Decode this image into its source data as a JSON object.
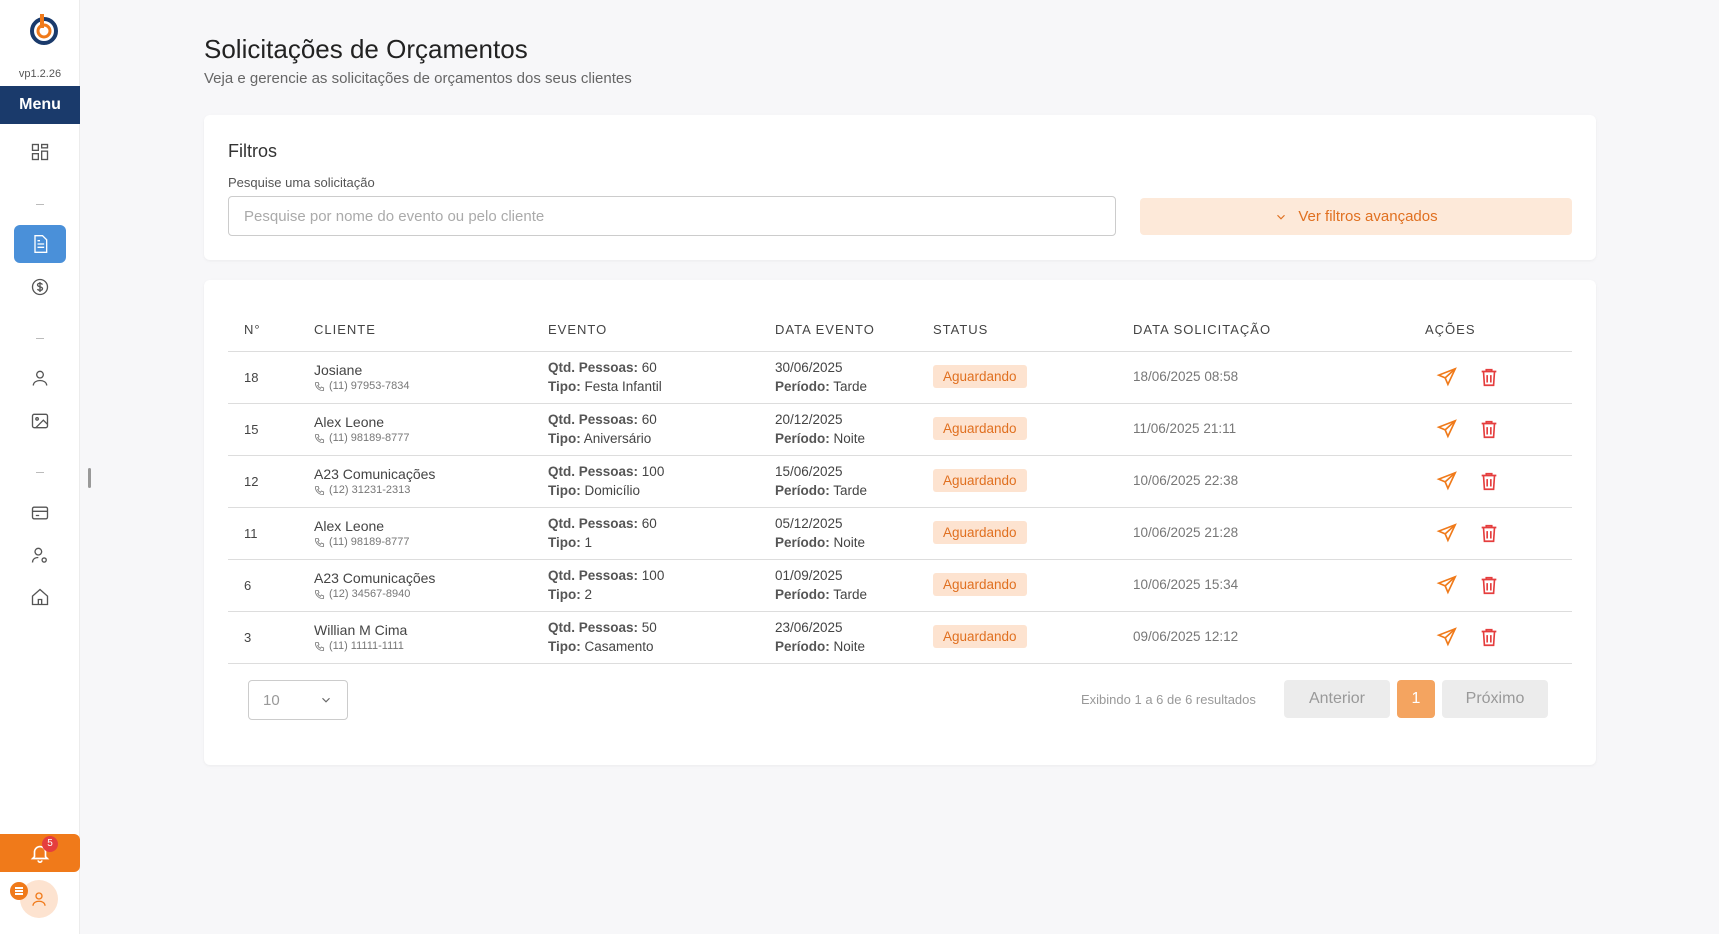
{
  "app": {
    "version": "vp1.2.26",
    "menu_label": "Menu",
    "notification_count": "5"
  },
  "header": {
    "title": "Solicitações de Orçamentos",
    "subtitle": "Veja e gerencie as solicitações de orçamentos dos seus clientes"
  },
  "filters": {
    "title": "Filtros",
    "search_label": "Pesquise uma solicitação",
    "search_placeholder": "Pesquise por nome do evento ou pelo cliente",
    "search_value": "",
    "advanced_label": "Ver filtros avançados"
  },
  "table": {
    "columns": [
      "N°",
      "CLIENTE",
      "EVENTO",
      "DATA EVENTO",
      "STATUS",
      "DATA SOLICITAÇÃO",
      "AÇÕES"
    ],
    "qtd_label": "Qtd. Pessoas:",
    "tipo_label": "Tipo:",
    "periodo_label": "Período:",
    "rows": [
      {
        "num": "18",
        "client": "Josiane",
        "phone": "(11) 97953-7834",
        "qtd": "60",
        "tipo": "Festa Infantil",
        "date": "30/06/2025",
        "periodo": "Tarde",
        "status": "Aguardando",
        "requested": "18/06/2025 08:58"
      },
      {
        "num": "15",
        "client": "Alex Leone",
        "phone": "(11) 98189-8777",
        "qtd": "60",
        "tipo": "Aniversário",
        "date": "20/12/2025",
        "periodo": "Noite",
        "status": "Aguardando",
        "requested": "11/06/2025 21:11"
      },
      {
        "num": "12",
        "client": "A23 Comunicações",
        "phone": "(12) 31231-2313",
        "qtd": "100",
        "tipo": "Domicílio",
        "date": "15/06/2025",
        "periodo": "Tarde",
        "status": "Aguardando",
        "requested": "10/06/2025 22:38"
      },
      {
        "num": "11",
        "client": "Alex Leone",
        "phone": "(11) 98189-8777",
        "qtd": "60",
        "tipo": "1",
        "date": "05/12/2025",
        "periodo": "Noite",
        "status": "Aguardando",
        "requested": "10/06/2025 21:28"
      },
      {
        "num": "6",
        "client": "A23 Comunicações",
        "phone": "(12) 34567-8940",
        "qtd": "100",
        "tipo": "2",
        "date": "01/09/2025",
        "periodo": "Tarde",
        "status": "Aguardando",
        "requested": "10/06/2025 15:34"
      },
      {
        "num": "3",
        "client": "Willian M Cima",
        "phone": "(11) 11111-1111",
        "qtd": "50",
        "tipo": "Casamento",
        "date": "23/06/2025",
        "periodo": "Noite",
        "status": "Aguardando",
        "requested": "09/06/2025 12:12"
      }
    ]
  },
  "pagination": {
    "page_size": "10",
    "results_text": "Exibindo 1 a 6 de 6 resultados",
    "prev_label": "Anterior",
    "current_page": "1",
    "next_label": "Próximo"
  },
  "colors": {
    "brand_dark": "#1a3a6b",
    "accent_orange": "#f07a1a",
    "active_blue": "#4a90d9",
    "danger": "#e53e3e"
  }
}
